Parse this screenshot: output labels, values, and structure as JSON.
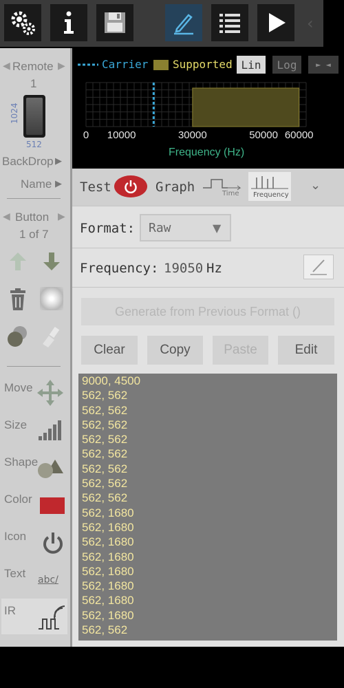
{
  "colors": {
    "toolbar_bg": "#3a3a3a",
    "panel_bg": "#e2e2e2",
    "left_bg": "#cfcfcf",
    "accent_blue": "#3aa8d8",
    "supported_fill": "#4f4a1e",
    "code_text": "#f3e6a0",
    "power_red": "#c0282d"
  },
  "toolbar": {
    "items": [
      "settings-icon",
      "info-icon",
      "save-icon",
      "edit-pencil-icon",
      "list-icon",
      "play-icon"
    ]
  },
  "left": {
    "remote_label": "Remote",
    "remote_number": "1",
    "height_value": "1024",
    "width_value": "512",
    "backdrop_label": "BackDrop",
    "name_label": "Name",
    "button_label": "Button",
    "button_count": "1 of 7",
    "move_label": "Move",
    "size_label": "Size",
    "shape_label": "Shape",
    "color_label": "Color",
    "icon_label": "Icon",
    "text_label": "Text",
    "ir_label": "IR",
    "text_sample": "abc/"
  },
  "graph": {
    "carrier_label": "Carrier",
    "supported_label": "Supported",
    "lin_label": "Lin",
    "log_label": "Log",
    "arrows_label": "► ◄",
    "xlabel": "Frequency (Hz)",
    "tick_labels": [
      "0",
      "10000",
      "30000",
      "50000",
      "60000"
    ],
    "tick_values": [
      0,
      10000,
      30000,
      50000,
      60000
    ],
    "x_range": [
      0,
      62000
    ],
    "carrier_hz": 19050,
    "supported_range": [
      30000,
      60000
    ]
  },
  "panel": {
    "test_label": "Test",
    "graph_label": "Graph",
    "time_label": "Time",
    "frequency_tab_label": "Frequency",
    "format_label": "Format:",
    "format_value": "Raw",
    "frequency_label": "Frequency:",
    "frequency_value": "19050",
    "frequency_unit": "Hz",
    "generate_label": "Generate from Previous Format ()",
    "clear_label": "Clear",
    "copy_label": "Copy",
    "paste_label": "Paste",
    "edit_label": "Edit"
  },
  "code_lines": [
    "9000, 4500",
    "562, 562",
    "562, 562",
    "562, 562",
    "562, 562",
    "562, 562",
    "562, 562",
    "562, 562",
    "562, 562",
    "562, 1680",
    "562, 1680",
    "562, 1680",
    "562, 1680",
    "562, 1680",
    "562, 1680",
    "562, 1680",
    "562, 1680",
    "562, 562"
  ]
}
